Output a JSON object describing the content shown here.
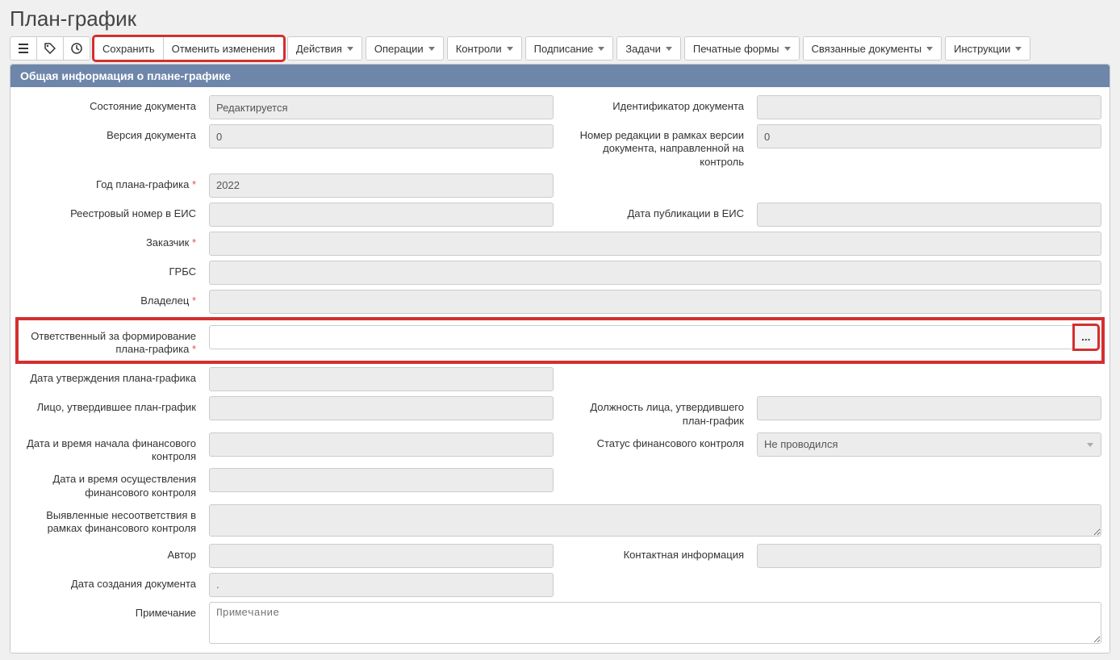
{
  "title": "План-график",
  "toolbar": {
    "save": "Сохранить",
    "cancel": "Отменить изменения",
    "actions": "Действия",
    "operations": "Операции",
    "controls": "Контроли",
    "signing": "Подписание",
    "tasks": "Задачи",
    "print_forms": "Печатные формы",
    "related_docs": "Связанные документы",
    "instructions": "Инструкции"
  },
  "section_title": "Общая информация о плане-графике",
  "labels": {
    "doc_state": "Состояние документа",
    "doc_version": "Версия документа",
    "doc_id": "Идентификатор документа",
    "edition_number": "Номер редакции в рамках версии документа, направленной на контроль",
    "plan_year": "Год плана-графика",
    "registry_number": "Реестровый номер в ЕИС",
    "pub_date": "Дата публикации в ЕИС",
    "customer": "Заказчик",
    "grbs": "ГРБС",
    "owner": "Владелец",
    "responsible": "Ответственный за формирование плана-графика",
    "approval_date": "Дата утверждения плана-графика",
    "approver": "Лицо, утвердившее план-график",
    "approver_position": "Должность лица, утвердившего план-график",
    "control_start": "Дата и время начала финансового контроля",
    "control_status": "Статус финансового контроля",
    "control_exec": "Дата и время осуществления финансового контроля",
    "mismatches": "Выявленные несоответствия в рамках финансового контроля",
    "author": "Автор",
    "contact": "Контактная информация",
    "create_date": "Дата создания документа",
    "note": "Примечание"
  },
  "values": {
    "doc_state": "Редактируется",
    "doc_version": "0",
    "doc_id": "",
    "edition_number": "0",
    "plan_year": "2022",
    "registry_number": "",
    "pub_date": "",
    "customer": "",
    "grbs": "",
    "owner": "",
    "responsible": "",
    "approval_date": "",
    "approver": "",
    "approver_position": "",
    "control_start": "",
    "control_status": "Не проводился",
    "control_exec": "",
    "mismatches": "",
    "author": "",
    "contact": "",
    "create_date": ".",
    "note": ""
  },
  "placeholders": {
    "note": "Примечание"
  },
  "lookup_btn": "..."
}
